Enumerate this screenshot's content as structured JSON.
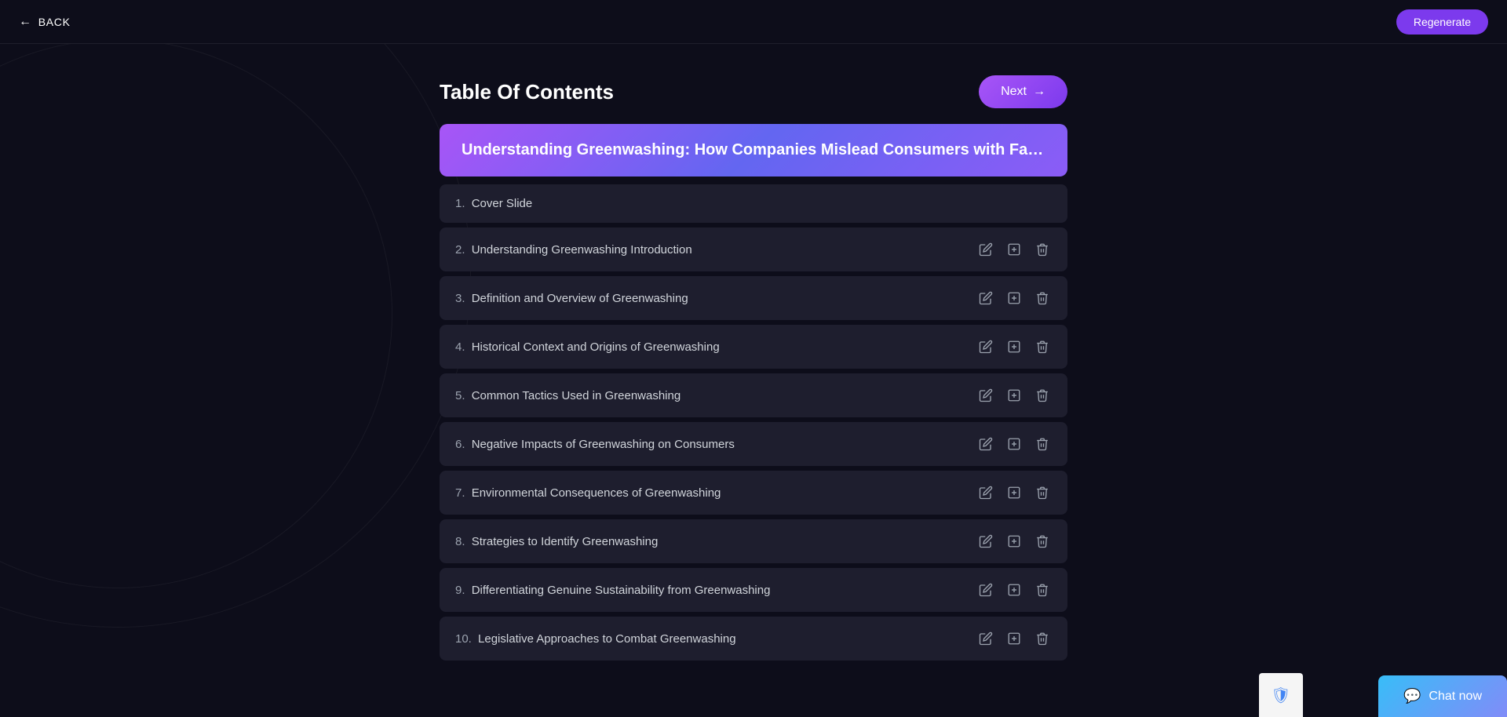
{
  "topbar": {
    "back_label": "BACK",
    "regenerate_label": "Regenerate"
  },
  "header": {
    "title": "Table Of Contents",
    "next_label": "Next"
  },
  "title_banner": {
    "text": "Understanding Greenwashing: How Companies Mislead Consumers with False ..."
  },
  "toc_items": [
    {
      "num": "1.",
      "label": "Cover Slide",
      "show_actions": false
    },
    {
      "num": "2.",
      "label": "Understanding Greenwashing Introduction",
      "show_actions": true
    },
    {
      "num": "3.",
      "label": "Definition and Overview of Greenwashing",
      "show_actions": true
    },
    {
      "num": "4.",
      "label": "Historical Context and Origins of Greenwashing",
      "show_actions": true
    },
    {
      "num": "5.",
      "label": "Common Tactics Used in Greenwashing",
      "show_actions": true
    },
    {
      "num": "6.",
      "label": "Negative Impacts of Greenwashing on Consumers",
      "show_actions": true
    },
    {
      "num": "7.",
      "label": "Environmental Consequences of Greenwashing",
      "show_actions": true
    },
    {
      "num": "8.",
      "label": "Strategies to Identify Greenwashing",
      "show_actions": true
    },
    {
      "num": "9.",
      "label": "Differentiating Genuine Sustainability from Greenwashing",
      "show_actions": true
    },
    {
      "num": "10.",
      "label": "Legislative Approaches to Combat Greenwashing",
      "show_actions": true
    }
  ],
  "chat_now": {
    "label": "Chat now"
  }
}
